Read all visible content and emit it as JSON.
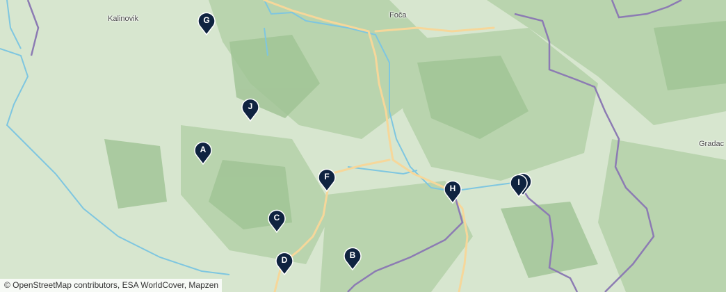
{
  "map": {
    "places": {
      "kalinovik": "Kalinovik",
      "foca": "Foča",
      "gradac": "Gradac"
    },
    "markers": {
      "a": "A",
      "b": "B",
      "c": "C",
      "d": "D",
      "f": "F",
      "g": "G",
      "h": "H",
      "i": "I",
      "j": "J"
    },
    "attribution": "© OpenStreetMap contributors, ESA WorldCover, Mapzen",
    "colors": {
      "land": "#d7e6cf",
      "forest": "#b9d4ae",
      "dark_forest": "#9fc394",
      "river": "#7ec6e0",
      "road": "#f6d79a",
      "border": "#8c7bb3",
      "marker": "#0f2340"
    }
  }
}
